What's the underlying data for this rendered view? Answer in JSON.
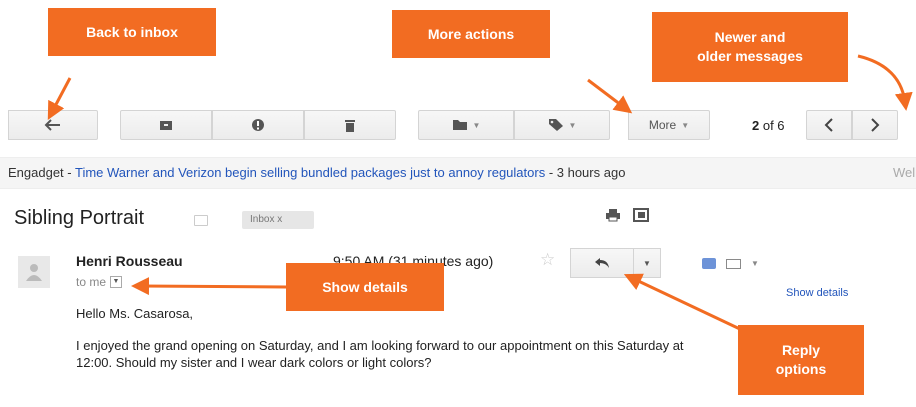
{
  "toolbar": {
    "back_icon": "back-arrow-icon",
    "archive_icon": "archive-icon",
    "spam_icon": "report-spam-icon",
    "delete_icon": "trash-icon",
    "move_icon": "folder-icon",
    "labels_icon": "label-icon",
    "more_label": "More",
    "count_current": "2",
    "count_text": " of 6",
    "prev_icon": "chevron-left-icon",
    "next_icon": "chevron-right-icon"
  },
  "web_clip": {
    "source": "Engadget",
    "separator": " - ",
    "headline": "Time Warner and Verizon begin selling bundled packages just to annoy regulators",
    "time": " - 3 hours ago",
    "trailing": "Wel"
  },
  "email": {
    "subject": "Sibling Portrait",
    "label_badge": "Inbox   x",
    "sender": "Henri Rousseau",
    "recipient": "to me",
    "timestamp": "9:50 AM (31 minutes ago)",
    "show_details": "Show details",
    "greeting": "Hello Ms. Casarosa,",
    "body": "I enjoyed the grand opening on Saturday, and I am looking forward to our appointment on this Saturday at 12:00. Should my sister and I wear dark colors or light colors?"
  },
  "callouts": {
    "back": "Back to inbox",
    "more": "More actions",
    "newer_older_1": "Newer and",
    "newer_older_2": "older messages",
    "show_details": "Show details",
    "reply_1": "Reply",
    "reply_2": "options"
  },
  "colors": {
    "callout": "#f26c22",
    "link": "#2255bb",
    "toolbar_button": "#f1f1f1"
  }
}
